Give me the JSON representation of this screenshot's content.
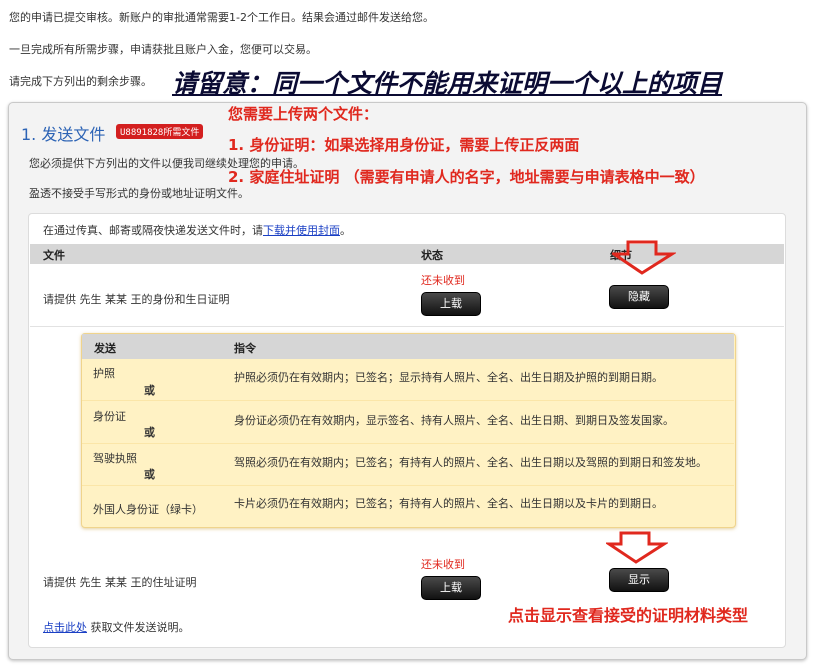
{
  "intro": {
    "line1": "您的申请已提交审核。新账户的审批通常需要1-2个工作日。结果会通过邮件发送给您。",
    "line2": "一旦完成所有所需步骤，申请获批且账户入金，您便可以交易。",
    "line3": "请完成下方列出的剩余步骤。"
  },
  "annotation": {
    "note": "请留意：同一个文件不能用来证明一个以上的项目",
    "upload_two": "您需要上传两个文件：",
    "item1": "1. 身份证明：如果选择用身份证，需要上传正反两面",
    "item2": "2. 家庭住址证明 （需要有申请人的名字，地址需要与申请表格中一致）",
    "show_hint": "点击显示查看接受的证明材料类型"
  },
  "step": {
    "title": "1. 发送文件",
    "badge": "U8891828所需文件",
    "desc1": "您必须提供下方列出的文件以便我司继续处理您的申请。",
    "desc2": "盈透不接受手写形式的身份或地址证明文件。"
  },
  "inner": {
    "cover_text": "在通过传真、邮寄或隔夜快递发送文件时，请",
    "cover_link": "下载并使用封面",
    "cover_end": "。",
    "headers": {
      "file": "文件",
      "status": "状态",
      "detail": "细节"
    },
    "row1": {
      "label": "请提供 先生 某某 王的身份和生日证明",
      "status": "还未收到",
      "upload": "上载",
      "action": "隐藏"
    },
    "row2": {
      "label": "请提供 先生 某某 王的住址证明",
      "status": "还未收到",
      "upload": "上载",
      "action": "显示"
    },
    "footer_link": "点击此处",
    "footer_text": " 获取文件发送说明。"
  },
  "doc_table": {
    "headers": {
      "send": "发送",
      "instruction": "指令"
    },
    "rows": [
      {
        "doc": "护照",
        "or": "或",
        "instruction": "护照必须仍在有效期内；已签名；显示持有人照片、全名、出生日期及护照的到期日期。"
      },
      {
        "doc": "身份证",
        "or": "或",
        "instruction": "身份证必须仍在有效期内，显示签名、持有人照片、全名、出生日期、到期日及签发国家。"
      },
      {
        "doc": "驾驶执照",
        "or": "或",
        "instruction": "驾照必须仍在有效期内；已签名；有持有人的照片、全名、出生日期以及驾照的到期日和签发地。"
      },
      {
        "doc": "外国人身份证（绿卡）",
        "or": "",
        "instruction": "卡片必须仍在有效期内；已签名；有持有人的照片、全名、出生日期以及卡片的到期日。"
      }
    ]
  }
}
